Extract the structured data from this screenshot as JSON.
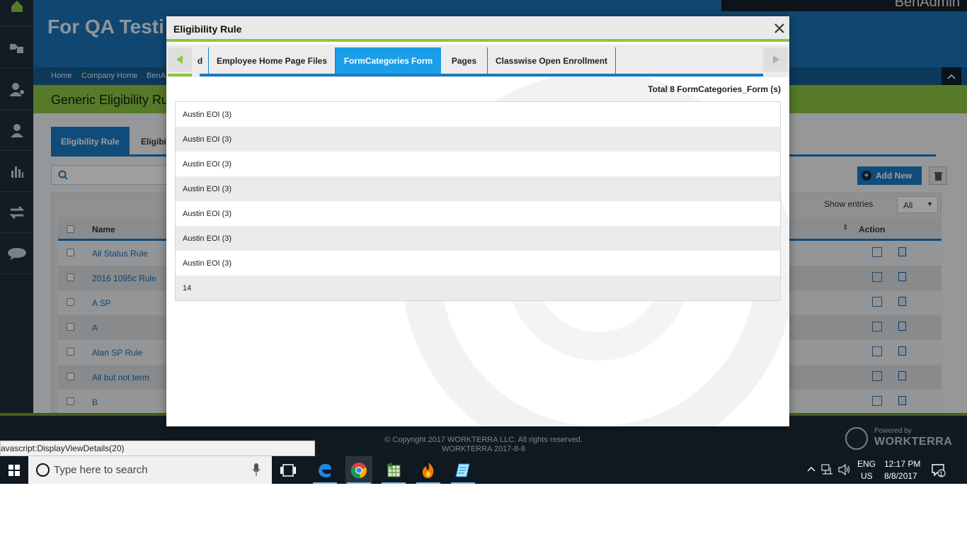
{
  "app": {
    "header_title": "For QA Testi",
    "user_name": "BenAdmin",
    "breadcrumb": [
      "Home",
      "Company Home",
      "BenA"
    ],
    "page_title": "Generic Eligibility Ru",
    "tabs": [
      "Eligibility Rule",
      "Eligibi"
    ],
    "add_new_label": "Add New",
    "show_entries_label": "Show entries",
    "show_entries_value": "All",
    "columns": {
      "name": "Name",
      "action": "Action"
    },
    "rows": [
      "All Status Rule",
      "2016 1095c Rule",
      "A SP",
      "A",
      "Alan SP Rule",
      "All but not term",
      "B"
    ]
  },
  "footer": {
    "copyright": "© Copyright 2017 WORKTERRA LLC. All rights reserved.",
    "build": "WORKTERRA 2017-8-8",
    "powered_by": "Powered by",
    "brand": "WORKTERRA"
  },
  "status_url": "avascript:DisplayViewDetails(20)",
  "modal": {
    "title": "Eligibility Rule",
    "tabs": [
      {
        "label": "d",
        "active": false
      },
      {
        "label": "Employee Home Page Files",
        "active": false
      },
      {
        "label": "FormCategories Form",
        "active": true
      },
      {
        "label": "Pages",
        "active": false
      },
      {
        "label": "Classwise Open Enrollment",
        "active": false
      }
    ],
    "total_text": "Total 8 FormCategories_Form (s)",
    "items": [
      "Austin EOI (3)",
      "Austin EOI (3)",
      "Austin EOI (3)",
      "Austin EOI (3)",
      "Austin EOI (3)",
      "Austin EOI (3)",
      "Austin EOI (3)",
      "14"
    ]
  },
  "taskbar": {
    "search_placeholder": "Type here to search",
    "lang_line1": "ENG",
    "lang_line2": "US",
    "time": "12:17 PM",
    "date": "8/8/2017",
    "notification_count": "1"
  },
  "colors": {
    "accent_blue": "#1a7bc4",
    "active_tab": "#1a9ee8",
    "brand_green": "#8cc63f",
    "header_blue": "#1a73b8"
  }
}
